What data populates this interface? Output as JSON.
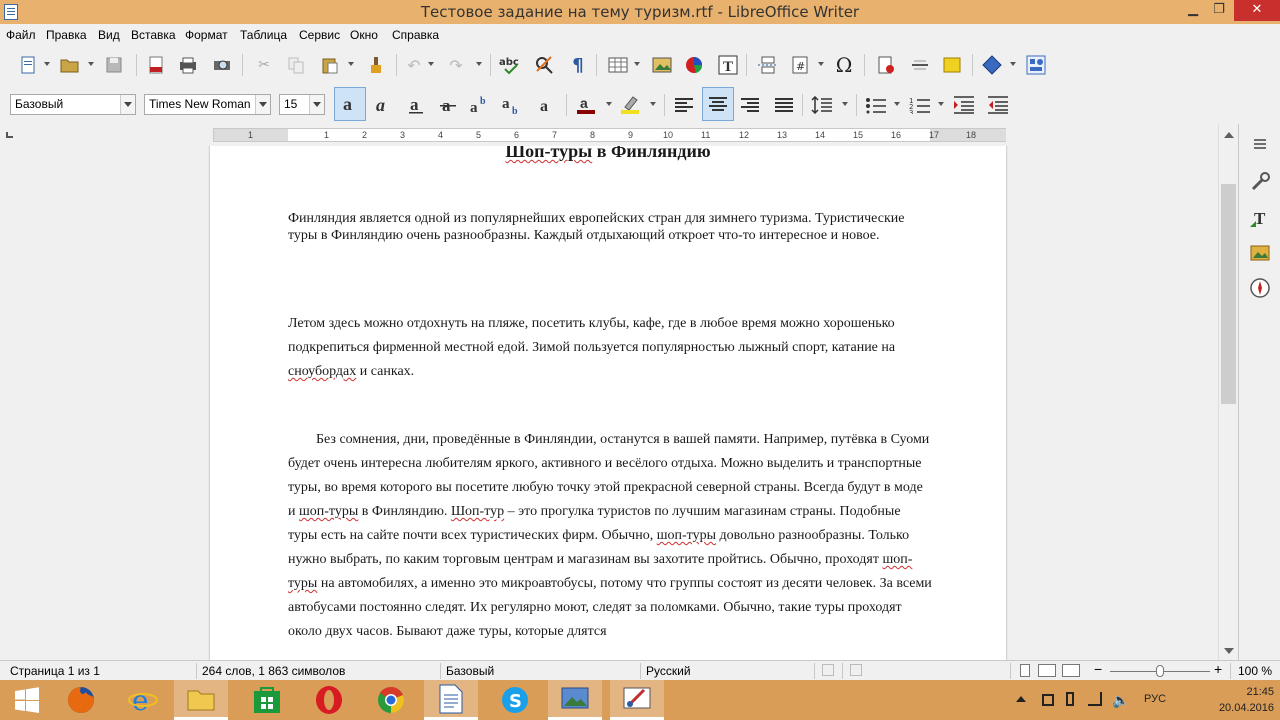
{
  "window": {
    "title": "Тестовое задание на тему туризм.rtf - LibreOffice Writer",
    "minimize": "▁",
    "maximize": "❐",
    "close": "✕"
  },
  "menu": [
    "Файл",
    "Правка",
    "Вид",
    "Вставка",
    "Формат",
    "Таблица",
    "Сервис",
    "Окно",
    "Справка"
  ],
  "formatting": {
    "paragraph_style": "Базовый",
    "font_name": "Times New Roman",
    "font_size": "15"
  },
  "ruler_numbers": [
    "1",
    "1",
    "2",
    "3",
    "4",
    "5",
    "6",
    "7",
    "8",
    "9",
    "10",
    "11",
    "12",
    "13",
    "14",
    "15",
    "16",
    "17",
    "18"
  ],
  "document": {
    "heading": "Шоп-туры в Финляндию",
    "heading_parts": [
      "Шоп-туры",
      " в Финляндию"
    ],
    "p1": "Финляндия является одной из популярнейших европейских стран для зимнего туризма. Туристические туры в Финляндию очень разнообразны. Каждый отдыхающий откроет что-то интересное и новое.",
    "p2_a": "Летом здесь можно отдохнуть на пляже, посетить клубы, кафе, где в любое время можно хорошенько подкрепиться фирменной местной едой. Зимой пользуется популярностью лыжный спорт, катание на ",
    "p2_sq": "сноубордах",
    "p2_b": " и санках.",
    "p3_a": "Без сомнения, дни, проведённые в Финляндии, останутся в вашей памяти. Например, путёвка в Суоми будет очень интересна любителям яркого, активного и весёлого отдыха. Можно выделить и транспортные туры, во время которого вы посетите любую точку этой прекрасной северной страны. Всегда будут в моде и ",
    "p3_sq1": "шоп-туры",
    "p3_b": " в Финляндию. ",
    "p3_sq2": "Шоп-тур",
    "p3_c": " – это прогулка туристов по лучшим магазинам страны. Подобные туры есть на сайте почти всех туристических фирм. Обычно, ",
    "p3_sq3": "шоп-туры",
    "p3_d": " довольно разнообразны. Только нужно выбрать, по каким торговым центрам и магазинам вы захотите пройтись. Обычно, проходят ",
    "p3_sq4": "шоп-туры",
    "p3_e": " на автомобилях, а именно это микроавтобусы, потому что группы состоят из десяти человек. За всеми автобусами постоянно следят. Их регулярно моют, следят за поломками. Обычно, такие туры проходят около двух часов. Бывают даже туры, которые длятся"
  },
  "status": {
    "page": "Страница 1 из 1",
    "words": "264 слов, 1 863 символов",
    "style": "Базовый",
    "language": "Русский",
    "zoom": "100 %",
    "zoom_minus": "−",
    "zoom_plus": "+"
  },
  "tray": {
    "lang": "РУС",
    "time": "21:45",
    "date": "20.04.2016"
  },
  "colors": {
    "titlebar": "#e8b16e",
    "taskbar": "#d99d58",
    "close": "#c7302c",
    "spellcheck": "#d03030"
  }
}
